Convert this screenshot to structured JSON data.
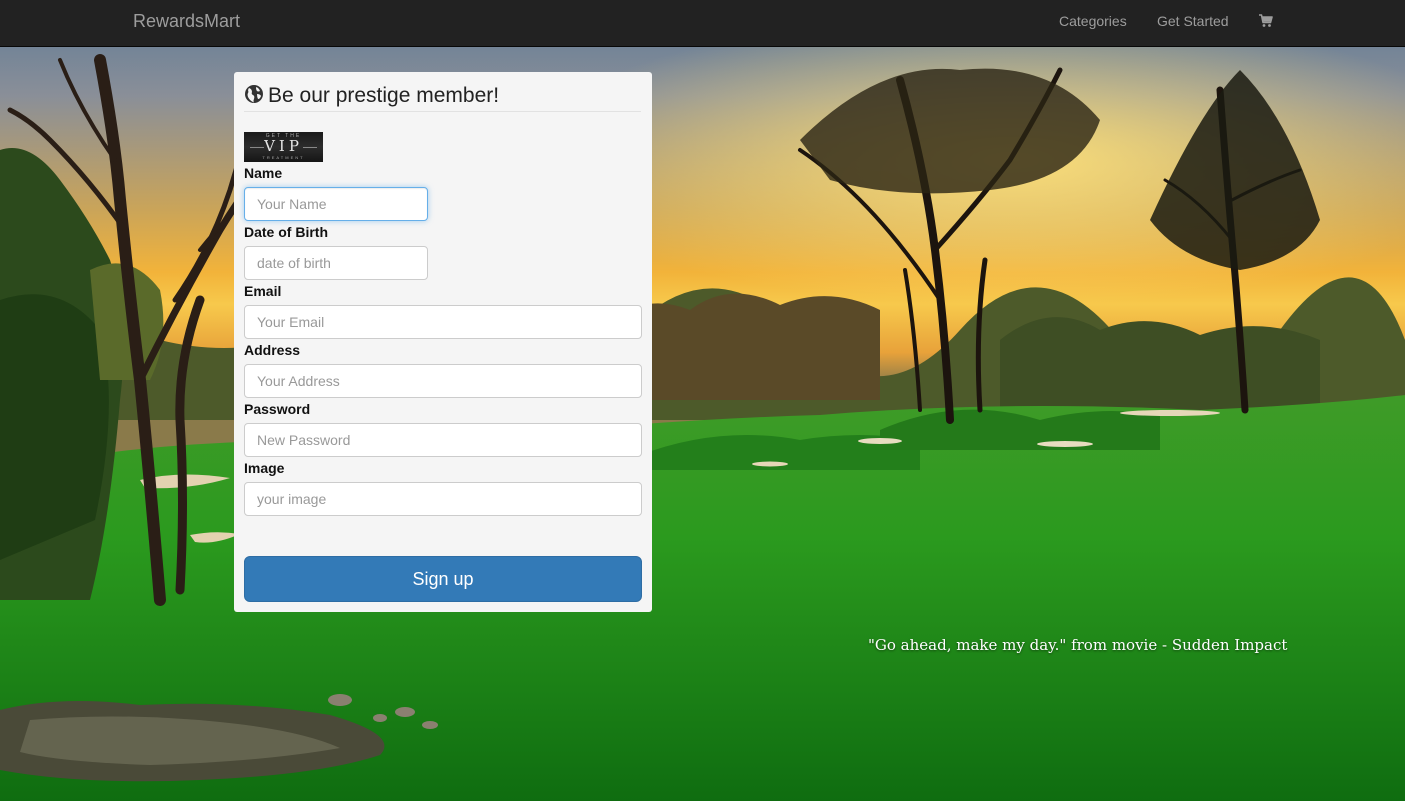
{
  "navbar": {
    "brand": "RewardsMart",
    "links": [
      {
        "label": "Categories"
      },
      {
        "label": "Get Started"
      }
    ],
    "cart_icon": "shopping-cart-icon"
  },
  "form": {
    "title": "Be our prestige member!",
    "title_icon": "globe-icon",
    "badge": {
      "top": "GET THE",
      "main": "VIP",
      "bottom": "TREATMENT"
    },
    "fields": [
      {
        "label": "Name",
        "placeholder": "Your Name",
        "value": ""
      },
      {
        "label": "Date of Birth",
        "placeholder": "date of birth",
        "value": ""
      },
      {
        "label": "Email",
        "placeholder": "Your Email",
        "value": ""
      },
      {
        "label": "Address",
        "placeholder": "Your Address",
        "value": ""
      },
      {
        "label": "Password",
        "placeholder": "New Password",
        "value": ""
      },
      {
        "label": "Image",
        "placeholder": "your image",
        "value": ""
      }
    ],
    "submit_label": "Sign up"
  },
  "quote": "\"Go ahead, make my day.\" from movie - Sudden Impact",
  "colors": {
    "navbar_bg": "#222222",
    "nav_text": "#9d9d9d",
    "primary_button": "#337ab7",
    "focus_border": "#66afe9",
    "panel_bg": "#f5f5f5"
  }
}
